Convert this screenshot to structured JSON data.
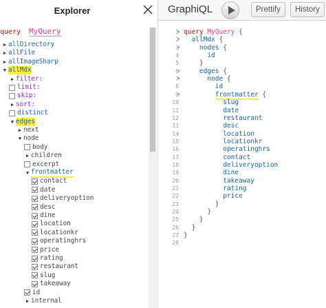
{
  "explorer": {
    "title": "Explorer",
    "close_icon": "close-icon",
    "operation": {
      "keyword": "query",
      "name": "MyQuery"
    },
    "rows": [
      {
        "label": "allDirectory",
        "indent": 0,
        "control": "arrow-right",
        "kind": "field"
      },
      {
        "label": "allFile",
        "indent": 0,
        "control": "arrow-right",
        "kind": "field"
      },
      {
        "label": "allImageSharp",
        "indent": 0,
        "control": "arrow-right",
        "kind": "field"
      },
      {
        "label": "allMdx",
        "indent": 0,
        "control": "arrow-down",
        "kind": "field",
        "highlight": true
      },
      {
        "label": "filter:",
        "indent": 1,
        "control": "arrow-right",
        "kind": "arg"
      },
      {
        "label": "limit:",
        "indent": 1,
        "control": "checkbox",
        "kind": "arg"
      },
      {
        "label": "skip:",
        "indent": 1,
        "control": "checkbox",
        "kind": "arg"
      },
      {
        "label": "sort:",
        "indent": 1,
        "control": "arrow-right",
        "kind": "arg"
      },
      {
        "label": "distinct",
        "indent": 1,
        "control": "checkbox",
        "kind": "field"
      },
      {
        "label": "edges",
        "indent": 1,
        "control": "arrow-down",
        "kind": "field",
        "highlight": true
      },
      {
        "label": "next",
        "indent": 2,
        "control": "arrow-right",
        "kind": "plain"
      },
      {
        "label": "node",
        "indent": 2,
        "control": "arrow-down",
        "kind": "plain"
      },
      {
        "label": "body",
        "indent": 3,
        "control": "checkbox",
        "kind": "plain"
      },
      {
        "label": "children",
        "indent": 3,
        "control": "arrow-right",
        "kind": "plain"
      },
      {
        "label": "excerpt",
        "indent": 3,
        "control": "checkbox",
        "kind": "plain"
      },
      {
        "label": "frontmatter",
        "indent": 3,
        "control": "arrow-down",
        "kind": "field",
        "underline": true
      },
      {
        "label": "contact",
        "indent": 4,
        "control": "checked",
        "kind": "plain"
      },
      {
        "label": "date",
        "indent": 4,
        "control": "checked",
        "kind": "plain"
      },
      {
        "label": "deliveryoption",
        "indent": 4,
        "control": "checked",
        "kind": "plain"
      },
      {
        "label": "desc",
        "indent": 4,
        "control": "checked",
        "kind": "plain"
      },
      {
        "label": "dine",
        "indent": 4,
        "control": "checked",
        "kind": "plain"
      },
      {
        "label": "location",
        "indent": 4,
        "control": "checked",
        "kind": "plain"
      },
      {
        "label": "locationkr",
        "indent": 4,
        "control": "checked",
        "kind": "plain"
      },
      {
        "label": "operatinghrs",
        "indent": 4,
        "control": "checked",
        "kind": "plain"
      },
      {
        "label": "price",
        "indent": 4,
        "control": "checked",
        "kind": "plain"
      },
      {
        "label": "rating",
        "indent": 4,
        "control": "checked",
        "kind": "plain"
      },
      {
        "label": "restaurant",
        "indent": 4,
        "control": "checked",
        "kind": "plain"
      },
      {
        "label": "slug",
        "indent": 4,
        "control": "checked",
        "kind": "plain"
      },
      {
        "label": "takeaway",
        "indent": 4,
        "control": "checked",
        "kind": "plain"
      },
      {
        "label": "id",
        "indent": 3,
        "control": "checked",
        "kind": "plain"
      },
      {
        "label": "internal",
        "indent": 3,
        "control": "arrow-right",
        "kind": "plain"
      }
    ]
  },
  "toolbar": {
    "logo": "GraphiQL",
    "run_icon": "play-icon",
    "prettify_label": "Prettify",
    "history_label": "History"
  },
  "editor": {
    "lines": [
      {
        "n": "1",
        "fold": true,
        "tokens": [
          {
            "t": "query ",
            "c": "kw"
          },
          {
            "t": "MyQuery",
            "c": "def"
          },
          {
            "t": " {",
            "c": "punc"
          }
        ]
      },
      {
        "n": "2",
        "fold": true,
        "tokens": [
          {
            "t": "  allMdx",
            "c": "prop"
          },
          {
            "t": " {",
            "c": "punc"
          }
        ]
      },
      {
        "n": "3",
        "fold": true,
        "tokens": [
          {
            "t": "    nodes",
            "c": "prop"
          },
          {
            "t": " {",
            "c": "punc"
          }
        ]
      },
      {
        "n": "4",
        "fold": false,
        "tokens": [
          {
            "t": "      id",
            "c": "prop"
          }
        ]
      },
      {
        "n": "5",
        "fold": false,
        "tokens": [
          {
            "t": "    }",
            "c": "punc"
          }
        ]
      },
      {
        "n": "6",
        "fold": true,
        "tokens": [
          {
            "t": "    edges",
            "c": "prop"
          },
          {
            "t": " {",
            "c": "punc"
          }
        ]
      },
      {
        "n": "7",
        "fold": true,
        "tokens": [
          {
            "t": "      node",
            "c": "prop"
          },
          {
            "t": " {",
            "c": "punc"
          }
        ]
      },
      {
        "n": "8",
        "fold": false,
        "tokens": [
          {
            "t": "        id",
            "c": "prop"
          }
        ]
      },
      {
        "n": "9",
        "fold": true,
        "tokens": [
          {
            "t": "        ",
            "c": "prop"
          },
          {
            "t": "frontmatter",
            "c": "prop",
            "hl": true
          },
          {
            "t": " {",
            "c": "punc"
          }
        ]
      },
      {
        "n": "10",
        "fold": false,
        "tokens": [
          {
            "t": "          slug",
            "c": "prop"
          }
        ]
      },
      {
        "n": "11",
        "fold": false,
        "tokens": [
          {
            "t": "          date",
            "c": "prop"
          }
        ]
      },
      {
        "n": "12",
        "fold": false,
        "tokens": [
          {
            "t": "          restaurant",
            "c": "prop"
          }
        ]
      },
      {
        "n": "13",
        "fold": false,
        "tokens": [
          {
            "t": "          desc",
            "c": "prop"
          }
        ]
      },
      {
        "n": "14",
        "fold": false,
        "tokens": [
          {
            "t": "          location",
            "c": "prop"
          }
        ]
      },
      {
        "n": "15",
        "fold": false,
        "tokens": [
          {
            "t": "          locationkr",
            "c": "prop"
          }
        ]
      },
      {
        "n": "16",
        "fold": false,
        "tokens": [
          {
            "t": "          operatinghrs",
            "c": "prop"
          }
        ]
      },
      {
        "n": "17",
        "fold": false,
        "tokens": [
          {
            "t": "          contact",
            "c": "prop"
          }
        ]
      },
      {
        "n": "18",
        "fold": false,
        "tokens": [
          {
            "t": "          deliveryoption",
            "c": "prop"
          }
        ]
      },
      {
        "n": "19",
        "fold": false,
        "tokens": [
          {
            "t": "          dine",
            "c": "prop"
          }
        ]
      },
      {
        "n": "20",
        "fold": false,
        "tokens": [
          {
            "t": "          takeaway",
            "c": "prop"
          }
        ]
      },
      {
        "n": "21",
        "fold": false,
        "tokens": [
          {
            "t": "          rating",
            "c": "prop"
          }
        ]
      },
      {
        "n": "22",
        "fold": false,
        "tokens": [
          {
            "t": "          price",
            "c": "prop"
          }
        ]
      },
      {
        "n": "23",
        "fold": false,
        "tokens": [
          {
            "t": "        }",
            "c": "punc"
          }
        ]
      },
      {
        "n": "24",
        "fold": false,
        "tokens": [
          {
            "t": "      }",
            "c": "punc"
          }
        ]
      },
      {
        "n": "25",
        "fold": false,
        "tokens": [
          {
            "t": "    }",
            "c": "punc"
          }
        ]
      },
      {
        "n": "26",
        "fold": false,
        "tokens": [
          {
            "t": "  }",
            "c": "punc"
          }
        ]
      },
      {
        "n": "27",
        "fold": false,
        "tokens": [
          {
            "t": "}",
            "c": "punc"
          }
        ]
      },
      {
        "n": "28",
        "fold": false,
        "tokens": []
      }
    ]
  },
  "colors": {
    "highlight": "#f7ec36",
    "keyword": "#b11a04",
    "definition": "#d64292",
    "property": "#1f61a0",
    "argument": "#8b2bb9"
  }
}
